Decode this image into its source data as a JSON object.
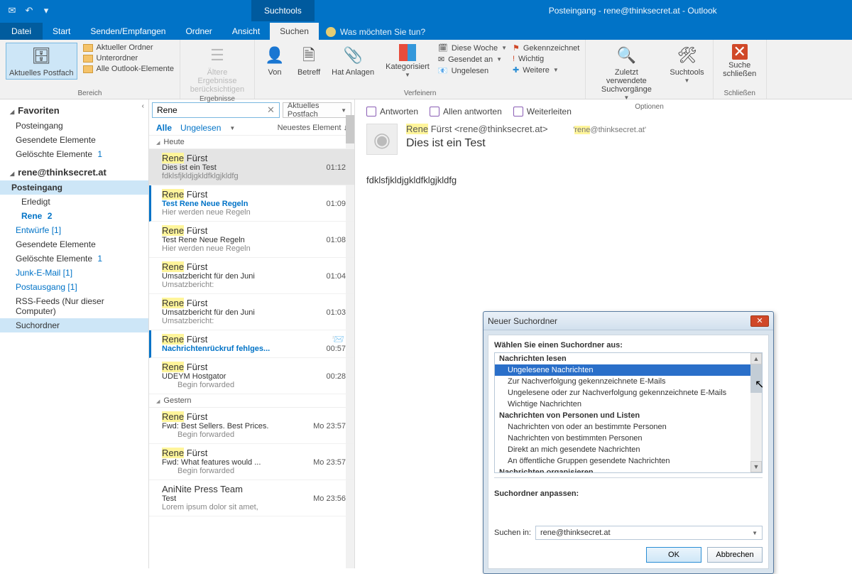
{
  "window": {
    "suchtools": "Suchtools",
    "title": "Posteingang - rene@thinksecret.at - Outlook"
  },
  "tabs": {
    "file": "Datei",
    "start": "Start",
    "senden": "Senden/Empfangen",
    "ordner": "Ordner",
    "ansicht": "Ansicht",
    "suchen": "Suchen",
    "tell": "Was möchten Sie tun?"
  },
  "ribbon": {
    "bereich": {
      "caption": "Bereich",
      "aktuelles": "Aktuelles Postfach",
      "aktueller_ordner": "Aktueller Ordner",
      "unterordner": "Unterordner",
      "alle": "Alle Outlook-Elemente"
    },
    "ergebnisse": {
      "caption": "Ergebnisse",
      "altere": "Ältere Ergebnisse berücksichtigen"
    },
    "verfeinern": {
      "caption": "Verfeinern",
      "von": "Von",
      "betreff": "Betreff",
      "hat_anlagen": "Hat Anlagen",
      "kategorisiert": "Kategorisiert",
      "diese_woche": "Diese Woche",
      "gesendet_an": "Gesendet an",
      "ungelesen": "Ungelesen",
      "gekennzeichnet": "Gekennzeichnet",
      "wichtig": "Wichtig",
      "weitere": "Weitere"
    },
    "optionen": {
      "caption": "Optionen",
      "zuletzt": "Zuletzt verwendete Suchvorgänge",
      "tools": "Suchtools"
    },
    "schliessen": {
      "caption": "Schließen",
      "suche": "Suche schließen"
    }
  },
  "nav": {
    "fav": "Favoriten",
    "fav_items": {
      "posteingang": "Posteingang",
      "gesendete": "Gesendete Elemente",
      "geloeschte": "Gelöschte Elemente",
      "geloeschte_cnt": "1"
    },
    "acct": "rene@thinksecret.at",
    "acct_items": {
      "posteingang": "Posteingang",
      "erledigt": "Erledigt",
      "rene": "Rene",
      "rene_cnt": "2",
      "entwuerfe": "Entwürfe [1]",
      "gesendete": "Gesendete Elemente",
      "geloeschte": "Gelöschte Elemente",
      "geloeschte_cnt": "1",
      "junk": "Junk-E-Mail [1]",
      "postausgang": "Postausgang [1]",
      "rss": "RSS-Feeds (Nur dieser Computer)",
      "suchordner": "Suchordner"
    }
  },
  "list": {
    "search_value": "Rene",
    "scope": "Aktuelles Postfach",
    "filter_alle": "Alle",
    "filter_ungelesen": "Ungelesen",
    "sort": "Neuestes Element ↓",
    "heute": "Heute",
    "gestern": "Gestern",
    "messages": [
      {
        "from_hi": "Rene",
        "from_rest": " Fürst",
        "subject": "Dies ist ein Test",
        "time": "01:12",
        "preview": "fdklsfjkldjgkldfklgjkldfg"
      },
      {
        "from_hi": "Rene",
        "from_rest": " Fürst",
        "subject": "Test Rene Neue Regeln",
        "time": "01:09",
        "preview": "Hier werden neue Regeln"
      },
      {
        "from_hi": "Rene",
        "from_rest": " Fürst",
        "subject": "Test Rene Neue Regeln",
        "time": "01:08",
        "preview": "Hier werden neue Regeln"
      },
      {
        "from_hi": "Rene",
        "from_rest": " Fürst",
        "subject": "Umsatzbericht für den Juni",
        "time": "01:04",
        "preview": "Umsatzbericht:"
      },
      {
        "from_hi": "Rene",
        "from_rest": " Fürst",
        "subject": "Umsatzbericht für den Juni",
        "time": "01:03",
        "preview": "Umsatzbericht:"
      },
      {
        "from_hi": "Rene",
        "from_rest": " Fürst",
        "subject": "Nachrichtenrückruf fehlges...",
        "time": "00:57",
        "preview": ""
      },
      {
        "from_hi": "Rene",
        "from_rest": " Fürst",
        "subject": "UDEYM Hostgator",
        "time": "00:28",
        "preview": "Begin forwarded"
      },
      {
        "from_hi": "Rene",
        "from_rest": " Fürst",
        "subject": "Fwd: Best Sellers. Best Prices.",
        "time": "Mo 23:57",
        "preview": "Begin forwarded"
      },
      {
        "from_hi": "Rene",
        "from_rest": " Fürst",
        "subject": "Fwd: What features would ...",
        "time": "Mo 23:57",
        "preview": "Begin forwarded"
      },
      {
        "from_plain": "AniNite Press Team",
        "subject": "Test",
        "time": "Mo 23:56",
        "preview": "Lorem ipsum dolor sit amet,"
      }
    ]
  },
  "reading": {
    "antworten": "Antworten",
    "allen": "Allen antworten",
    "weiterleiten": "Weiterleiten",
    "from_hi": "Rene",
    "from_rest": " Fürst <rene@thinksecret.at>",
    "to_hi": "rene",
    "to_rest": "@thinksecret.at",
    "subject": "Dies ist ein Test",
    "body": "fdklsfjkldjgkldfklgjkldfg"
  },
  "dialog": {
    "title": "Neuer Suchordner",
    "prompt": "Wählen Sie einen Suchordner aus:",
    "cat1": "Nachrichten lesen",
    "o1": "Ungelesene Nachrichten",
    "o2": "Zur Nachverfolgung gekennzeichnete E-Mails",
    "o3": "Ungelesene oder zur Nachverfolgung gekennzeichnete E-Mails",
    "o4": "Wichtige Nachrichten",
    "cat2": "Nachrichten von Personen und Listen",
    "o5": "Nachrichten von oder an bestimmte Personen",
    "o6": "Nachrichten von bestimmten Personen",
    "o7": "Direkt an mich gesendete Nachrichten",
    "o8": "An öffentliche Gruppen gesendete Nachrichten",
    "cat3": "Nachrichten organisieren",
    "customize": "Suchordner anpassen:",
    "search_in_label": "Suchen in:",
    "search_in_value": "rene@thinksecret.at",
    "ok": "OK",
    "cancel": "Abbrechen"
  }
}
